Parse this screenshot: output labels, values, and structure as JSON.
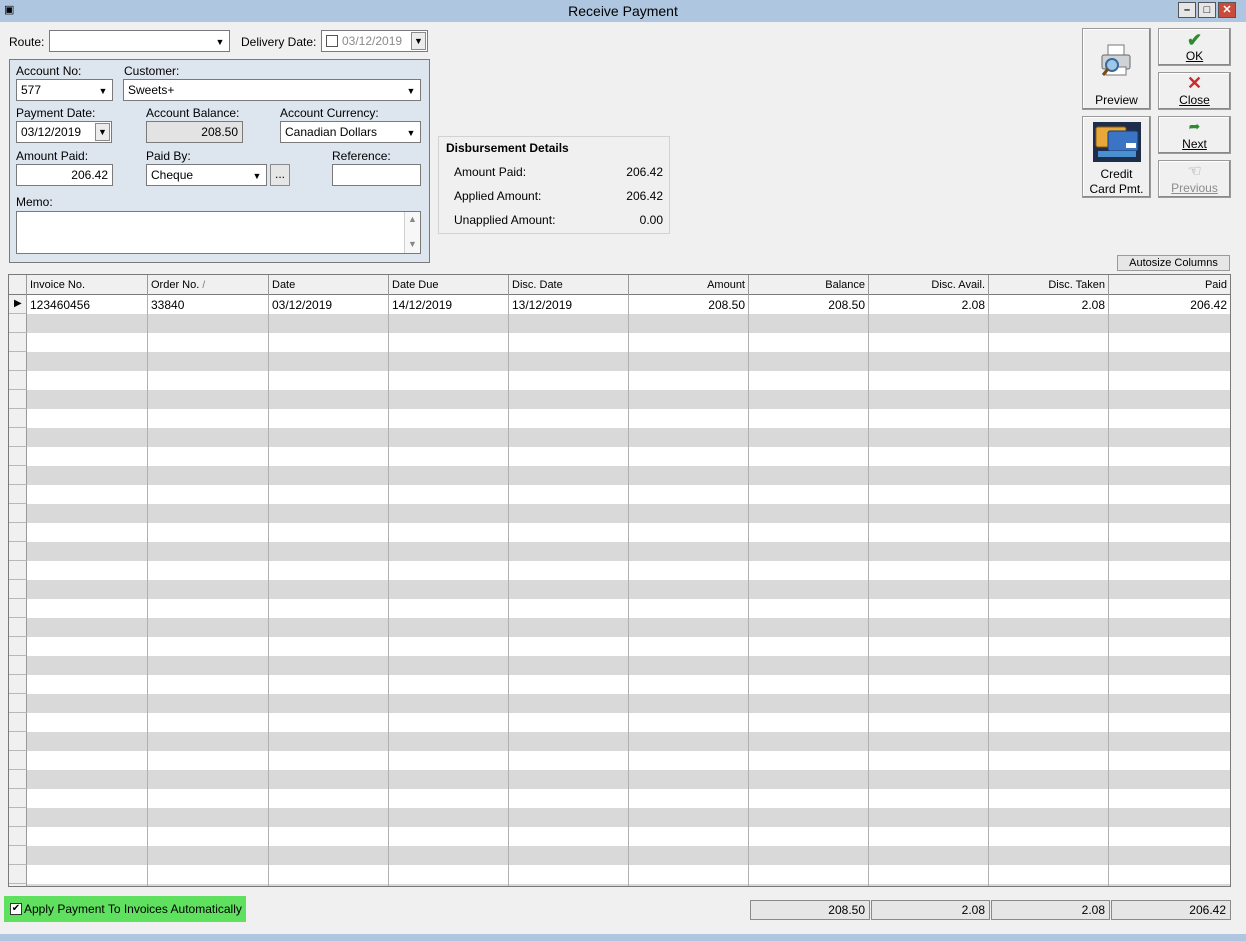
{
  "window": {
    "title": "Receive Payment",
    "app_icon": "app-icon"
  },
  "route": {
    "label": "Route:",
    "value": ""
  },
  "delivery_date": {
    "label": "Delivery Date:",
    "value": "03/12/2019",
    "checked": false
  },
  "account_no": {
    "label": "Account No:",
    "value": "577"
  },
  "customer": {
    "label": "Customer:",
    "value": "Sweets+"
  },
  "payment_date": {
    "label": "Payment Date:",
    "value": "03/12/2019"
  },
  "account_balance": {
    "label": "Account Balance:",
    "value": "208.50"
  },
  "account_currency": {
    "label": "Account Currency:",
    "value": "Canadian Dollars"
  },
  "amount_paid": {
    "label": "Amount Paid:",
    "value": "206.42"
  },
  "paid_by": {
    "label": "Paid By:",
    "value": "Cheque",
    "browse_label": "..."
  },
  "reference": {
    "label": "Reference:",
    "value": ""
  },
  "memo": {
    "label": "Memo:",
    "value": ""
  },
  "disbursement": {
    "title": "Disbursement Details",
    "rows": [
      {
        "label": "Amount Paid:",
        "value": "206.42"
      },
      {
        "label": "Applied Amount:",
        "value": "206.42"
      },
      {
        "label": "Unapplied Amount:",
        "value": "0.00"
      }
    ]
  },
  "buttons": {
    "preview": "Preview",
    "ok": "OK",
    "close": "Close",
    "credit_card_line1": "Credit",
    "credit_card_line2": "Card Pmt.",
    "next": "Next",
    "previous": "Previous",
    "autosize": "Autosize Columns"
  },
  "grid": {
    "columns": [
      "Invoice No.",
      "Order No.",
      "Date",
      "Date Due",
      "Disc. Date",
      "Amount",
      "Balance",
      "Disc. Avail.",
      "Disc. Taken",
      "Paid"
    ],
    "sort_indicator": "/",
    "rows": [
      [
        "123460456",
        "33840",
        "03/12/2019",
        "14/12/2019",
        "13/12/2019",
        "208.50",
        "208.50",
        "2.08",
        "2.08",
        "206.42"
      ]
    ]
  },
  "apply_auto": {
    "label": "Apply Payment To Invoices Automatically",
    "checked": true,
    "highlight": "#5fe05f"
  },
  "totals": {
    "amount": "208.50",
    "disc_avail": "2.08",
    "disc_taken": "2.08",
    "paid": "206.42"
  }
}
